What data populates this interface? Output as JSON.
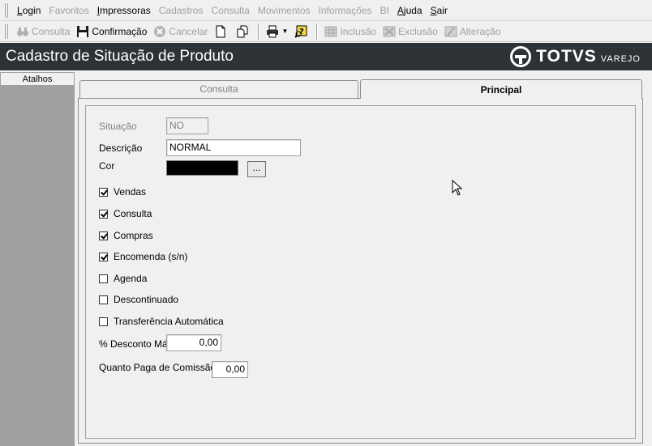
{
  "menu": [
    {
      "label": "Login",
      "underline": "L",
      "rest": "ogin",
      "enabled": true
    },
    {
      "label": "Favoritos",
      "underline": "",
      "rest": "Favoritos",
      "enabled": false
    },
    {
      "label": "Impressoras",
      "underline": "I",
      "rest": "mpressoras",
      "enabled": true
    },
    {
      "label": "Cadastros",
      "underline": "",
      "rest": "Cadastros",
      "enabled": false
    },
    {
      "label": "Consulta",
      "underline": "",
      "rest": "Consulta",
      "enabled": false
    },
    {
      "label": "Movimentos",
      "underline": "",
      "rest": "Movimentos",
      "enabled": false
    },
    {
      "label": "Informações",
      "underline": "",
      "rest": "Informações",
      "enabled": false
    },
    {
      "label": "BI",
      "underline": "",
      "rest": "BI",
      "enabled": false
    },
    {
      "label": "Ajuda",
      "underline": "A",
      "rest": "juda",
      "enabled": true
    },
    {
      "label": "Sair",
      "underline": "S",
      "rest": "air",
      "enabled": true
    }
  ],
  "toolbar": {
    "consulta": "Consulta",
    "confirmacao": "Confirmação",
    "cancelar": "Cancelar",
    "inclusao": "Inclusão",
    "exclusao": "Exclusão",
    "alteracao": "Alteração"
  },
  "title": "Cadastro de Situação de Produto",
  "logo": {
    "brand": "TOTVS",
    "sub": "VAREJO"
  },
  "shortcuts": {
    "header": "Atalhos"
  },
  "tabs": {
    "consulta": "Consulta",
    "principal": "Principal"
  },
  "form": {
    "situacao_label": "Situação",
    "situacao_value": "NO",
    "descricao_label": "Descrição",
    "descricao_value": "NORMAL",
    "cor_label": "Cor",
    "cor_value": "#000000",
    "cor_button": "...",
    "checkboxes": [
      {
        "label": "Vendas",
        "checked": true
      },
      {
        "label": "Consulta",
        "checked": true
      },
      {
        "label": "Compras",
        "checked": true
      },
      {
        "label": "Encomenda (s/n)",
        "checked": true
      },
      {
        "label": "Agenda",
        "checked": false
      },
      {
        "label": "Descontinuado",
        "checked": false
      },
      {
        "label": "Transferência Automática",
        "checked": false
      }
    ],
    "desconto_label": "% Desconto Máx.",
    "desconto_value": "0,00",
    "comissao_label": "Quanto Paga de Comissão",
    "comissao_value": "0,00"
  }
}
